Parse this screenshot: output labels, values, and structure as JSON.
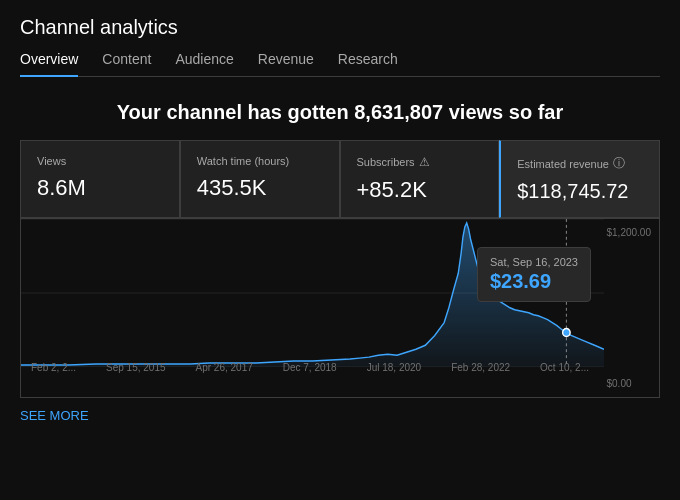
{
  "header": {
    "title": "Channel analytics"
  },
  "tabs": [
    {
      "label": "Overview",
      "active": true
    },
    {
      "label": "Content",
      "active": false
    },
    {
      "label": "Audience",
      "active": false
    },
    {
      "label": "Revenue",
      "active": false
    },
    {
      "label": "Research",
      "active": false
    }
  ],
  "headline": "Your channel has gotten 8,631,807 views so far",
  "metrics": [
    {
      "label": "Views",
      "value": "8.6M",
      "icon": null
    },
    {
      "label": "Watch time (hours)",
      "value": "435.5K",
      "icon": null
    },
    {
      "label": "Subscribers",
      "value": "+85.2K",
      "icon": "warning"
    },
    {
      "label": "Estimated revenue",
      "value": "$118,745.72",
      "icon": "info"
    }
  ],
  "chart": {
    "y_labels": [
      "$1,200.00",
      "$0.00"
    ],
    "x_labels": [
      "Feb 2, 2...",
      "Sep 15, 2015",
      "Apr 26, 2017",
      "Dec 7, 2018",
      "Jul 18, 2020",
      "Feb 28, 2022",
      "Oct 10, 2..."
    ],
    "tooltip": {
      "date": "Sat, Sep 16, 2023",
      "value": "$23.69"
    }
  },
  "see_more": "SEE MORE"
}
